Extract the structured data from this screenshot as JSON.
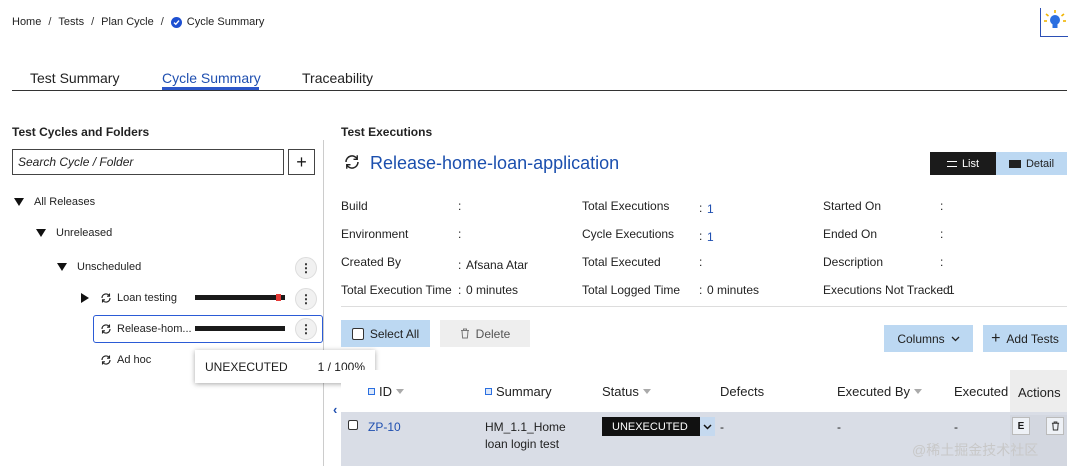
{
  "breadcrumb": {
    "items": [
      "Home",
      "Tests",
      "Plan Cycle"
    ],
    "current": "Cycle Summary",
    "separator": "/"
  },
  "tabs": [
    {
      "label": "Test Summary"
    },
    {
      "label": "Cycle Summary",
      "active": true
    },
    {
      "label": "Traceability"
    }
  ],
  "left_panel": {
    "title": "Test Cycles and Folders",
    "search_placeholder": "Search Cycle / Folder",
    "add_label": "+",
    "tree": {
      "root": "All Releases",
      "release": "Unreleased",
      "group": "Unscheduled",
      "cycles": [
        {
          "label": "Loan testing",
          "progress": 0.95,
          "indicator_color": "#e53935"
        },
        {
          "label": "Release-hom...",
          "progress": 1.0,
          "selected": true
        },
        {
          "label": "Ad hoc"
        }
      ]
    },
    "tooltip": {
      "status": "UNEXECUTED",
      "value": "1 / 100%"
    }
  },
  "right_panel": {
    "title": "Test Executions",
    "cycle_name": "Release-home-loan-application",
    "view_toggle": {
      "list": "List",
      "detail": "Detail"
    },
    "info": {
      "col1": [
        {
          "label": "Build",
          "value": ""
        },
        {
          "label": "Environment",
          "value": ""
        },
        {
          "label": "Created By",
          "value": "Afsana Atar"
        },
        {
          "label": "Total Execution Time",
          "value": "0 minutes"
        }
      ],
      "col2": [
        {
          "label": "Total Executions",
          "value": "1"
        },
        {
          "label": "Cycle Executions",
          "value": "1"
        },
        {
          "label": "Total Executed",
          "value": ""
        },
        {
          "label": "Total Logged Time",
          "value": "0 minutes"
        }
      ],
      "col3": [
        {
          "label": "Started On",
          "value": ""
        },
        {
          "label": "Ended On",
          "value": ""
        },
        {
          "label": "Description",
          "value": ""
        },
        {
          "label": "Executions Not Tracked",
          "value": "1"
        }
      ]
    },
    "toolbar": {
      "select_all": "Select All",
      "delete": "Delete",
      "columns": "Columns",
      "add_tests": "Add Tests"
    },
    "table": {
      "headers": [
        "ID",
        "Summary",
        "Status",
        "Defects",
        "Executed By",
        "Executed",
        "Actions"
      ],
      "rows": [
        {
          "id": "ZP-10",
          "summary_line1": "HM_1.1_Home",
          "summary_line2": "loan login test",
          "status": "UNEXECUTED",
          "defects": "-",
          "executed_by": "-",
          "executed": "-",
          "action_execute": "E"
        }
      ]
    }
  },
  "watermark": "@稀土掘金技术社区",
  "colors": {
    "accent": "#2c56c9",
    "link": "#1f4fb0",
    "light_button": "#bcd8f2",
    "status_badge": "#111111"
  }
}
